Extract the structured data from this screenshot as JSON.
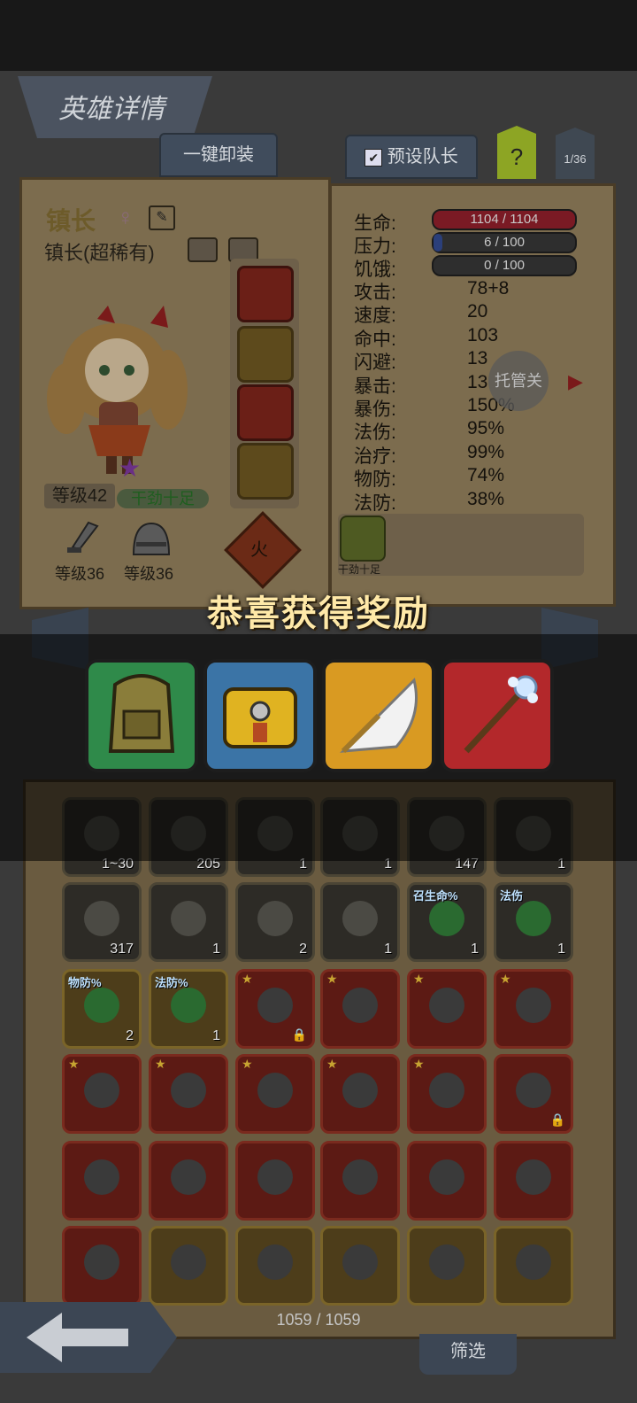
{
  "header": {
    "title": "英雄详情"
  },
  "tabs": {
    "unequip_all": "一键卸装",
    "preset_leader": "预设队长",
    "help": "?",
    "page": "1/36"
  },
  "hero": {
    "name": "镇长",
    "gender_icon": "female-icon",
    "subtitle": "镇长(超稀有)",
    "level": "等级42",
    "status": "干劲十足",
    "weapon_level": "等级36",
    "armor_level": "等级36",
    "element": "火",
    "trait_label": "干劲十足"
  },
  "stats": {
    "hp_label": "生命:",
    "hp_value": "1104 / 1104",
    "hp_fraction": 1.0,
    "stress_label": "压力:",
    "stress_value": "6 / 100",
    "stress_fraction": 0.06,
    "hunger_label": "饥饿:",
    "hunger_value": "0 / 100",
    "hunger_fraction": 0.0,
    "rows": [
      {
        "label": "攻击:",
        "value": "78+8"
      },
      {
        "label": "速度:",
        "value": "20"
      },
      {
        "label": "命中:",
        "value": "103"
      },
      {
        "label": "闪避:",
        "value": "13"
      },
      {
        "label": "暴击:",
        "value": "13"
      },
      {
        "label": "暴伤:",
        "value": "150%"
      },
      {
        "label": "法伤:",
        "value": "95%"
      },
      {
        "label": "治疗:",
        "value": "99%"
      },
      {
        "label": "物防:",
        "value": "74%"
      },
      {
        "label": "法防:",
        "value": "38%"
      }
    ],
    "auto_button": "托管关"
  },
  "reward": {
    "title": "恭喜获得奖励",
    "items": [
      {
        "icon": "green-backpack-icon",
        "frame": "#2f8a4a"
      },
      {
        "icon": "yellow-bag-icon",
        "frame": "#3b74a6"
      },
      {
        "icon": "feather-fan-icon",
        "frame": "#d99a22"
      },
      {
        "icon": "crystal-staff-icon",
        "frame": "#b3282b"
      }
    ]
  },
  "inventory": {
    "counter": "1059 / 1059",
    "filter": "筛选",
    "rows": [
      [
        {
          "icon": "hero-portrait-icon",
          "count": "1~30",
          "style": "dark"
        },
        {
          "icon": "rune-stone-icon",
          "count": "205",
          "style": "dark"
        },
        {
          "icon": "scroll-icon",
          "count": "1",
          "style": "dark"
        },
        {
          "icon": "crystal-pile-icon",
          "count": "1",
          "style": "dark"
        },
        {
          "icon": "dark-orb-icon",
          "count": "147",
          "style": "dark"
        },
        {
          "icon": "meat-icon",
          "count": "1",
          "style": "dark"
        }
      ],
      [
        {
          "icon": "potion-icon",
          "count": "317",
          "style": "dark"
        },
        {
          "icon": "ticket-icon",
          "count": "1",
          "style": "dark"
        },
        {
          "icon": "hooded-figure-icon",
          "count": "2",
          "style": "dark"
        },
        {
          "icon": "white-feather-icon",
          "count": "1",
          "style": "dark"
        },
        {
          "icon": "green-gem-icon",
          "count": "1",
          "style": "dark",
          "tag": "召生命%"
        },
        {
          "icon": "green-gem-icon",
          "count": "1",
          "style": "dark",
          "tag": "法伤"
        }
      ],
      [
        {
          "icon": "green-gem-icon",
          "count": "2",
          "style": "gold",
          "tag": "物防%"
        },
        {
          "icon": "green-gem-icon",
          "count": "1",
          "style": "gold",
          "tag": "法防%"
        },
        {
          "icon": "gauntlet-icon",
          "style": "red",
          "star": true,
          "lock": true
        },
        {
          "icon": "green-flask-icon",
          "style": "red",
          "star": true
        },
        {
          "icon": "battle-axe-icon",
          "style": "red",
          "star": true
        },
        {
          "icon": "skull-cape-icon",
          "style": "red",
          "star": true
        }
      ],
      [
        {
          "icon": "rifle-icon",
          "style": "red",
          "star": true
        },
        {
          "icon": "sword-icon",
          "style": "red",
          "star": true
        },
        {
          "icon": "spellbook-icon",
          "style": "red",
          "star": true
        },
        {
          "icon": "scepter-icon",
          "style": "red",
          "star": true
        },
        {
          "icon": "staff-icon",
          "style": "red",
          "star": true
        },
        {
          "icon": "shield-emblem-icon",
          "style": "red",
          "lock": true
        }
      ],
      [
        {
          "icon": "dagger-icon",
          "style": "red"
        },
        {
          "icon": "green-feather-icon",
          "style": "red"
        },
        {
          "icon": "claw-icon",
          "style": "red"
        },
        {
          "icon": "amulet-icon",
          "style": "red"
        },
        {
          "icon": "fire-orb-icon",
          "style": "red"
        },
        {
          "icon": "helmet-crest-icon",
          "style": "red"
        }
      ],
      [
        {
          "icon": "wand-icon",
          "style": "red"
        },
        {
          "icon": "gauntlet-icon",
          "style": "gold"
        },
        {
          "icon": "gauntlet-icon",
          "style": "gold"
        },
        {
          "icon": "gauntlet-icon",
          "style": "gold"
        },
        {
          "icon": "gauntlet-icon",
          "style": "gold"
        },
        {
          "icon": "gauntlet-icon",
          "style": "gold"
        }
      ]
    ]
  }
}
